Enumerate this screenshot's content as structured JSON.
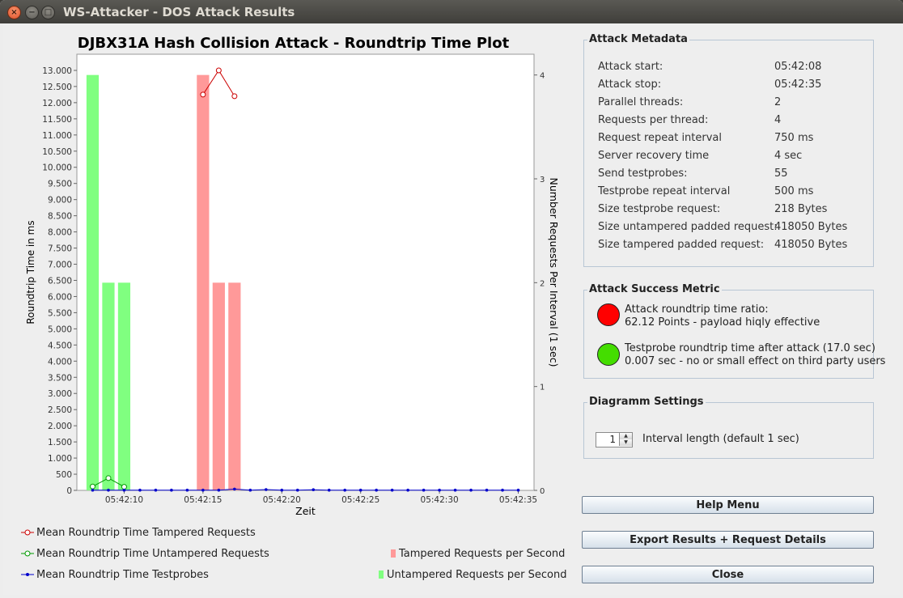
{
  "window": {
    "title": "WS-Attacker - DOS Attack Results",
    "close_glyph": "×",
    "min_glyph": "−",
    "max_glyph": "□"
  },
  "chart_data": {
    "type": "bar",
    "title": "DJBX31A Hash Collision Attack - Roundtrip Time Plot",
    "xlabel": "Zeit",
    "ylabel": "Roundtrip Time in ms",
    "y2label": "Number Requests Per Interval (1 sec)",
    "y_ticks": [
      "0",
      "500",
      "1.000",
      "1.500",
      "2.000",
      "2.500",
      "3.000",
      "3.500",
      "4.000",
      "4.500",
      "5.000",
      "5.500",
      "6.000",
      "6.500",
      "7.000",
      "7.500",
      "8.000",
      "8.500",
      "9.000",
      "9.500",
      "10.000",
      "10.500",
      "11.000",
      "11.500",
      "12.000",
      "12.500",
      "13.000"
    ],
    "y2_ticks": [
      "0",
      "1",
      "2",
      "3",
      "4"
    ],
    "x_ticks": [
      "05:42:10",
      "05:42:15",
      "05:42:20",
      "05:42:25",
      "05:42:30",
      "05:42:35"
    ],
    "x_range": [
      "05:42:07",
      "05:42:36"
    ],
    "ylim": [
      0,
      13500
    ],
    "y2lim": [
      0,
      4.2
    ],
    "grid": false,
    "bar_series": [
      {
        "name": "Untampered Requests per Second",
        "color": "#80ff80",
        "x": [
          "05:42:08",
          "05:42:09",
          "05:42:10"
        ],
        "values": [
          4,
          2,
          2
        ]
      },
      {
        "name": "Tampered Requests per Second",
        "color": "#ff9999",
        "x": [
          "05:42:15",
          "05:42:16",
          "05:42:17"
        ],
        "values": [
          4,
          2,
          2
        ]
      }
    ],
    "line_series": [
      {
        "name": "Mean Roundtrip Time Tampered Requests",
        "color": "#cc0000",
        "x": [
          "05:42:15",
          "05:42:16",
          "05:42:17"
        ],
        "values": [
          12250,
          13000,
          12200
        ]
      },
      {
        "name": "Mean Roundtrip Time Untampered Requests",
        "color": "#009900",
        "x": [
          "05:42:08",
          "05:42:09",
          "05:42:10"
        ],
        "values": [
          120,
          380,
          110
        ]
      },
      {
        "name": "Mean Roundtrip Time Testprobes",
        "color": "#0000cc",
        "x": [
          "05:42:08",
          "05:42:09",
          "05:42:10",
          "05:42:11",
          "05:42:12",
          "05:42:13",
          "05:42:14",
          "05:42:15",
          "05:42:16",
          "05:42:17",
          "05:42:18",
          "05:42:19",
          "05:42:20",
          "05:42:21",
          "05:42:22",
          "05:42:23",
          "05:42:24",
          "05:42:25",
          "05:42:26",
          "05:42:27",
          "05:42:28",
          "05:42:29",
          "05:42:30",
          "05:42:31",
          "05:42:32",
          "05:42:33",
          "05:42:34",
          "05:42:35"
        ],
        "values": [
          7,
          7,
          7,
          7,
          7,
          7,
          7,
          7,
          7,
          40,
          7,
          25,
          7,
          7,
          20,
          7,
          7,
          7,
          7,
          7,
          7,
          7,
          7,
          7,
          7,
          7,
          7,
          7
        ]
      }
    ],
    "legend_order_left": [
      "Mean Roundtrip Time Tampered Requests",
      "Mean Roundtrip Time Untampered Requests",
      "Mean Roundtrip Time Testprobes"
    ],
    "legend_order_right": [
      "Tampered Requests per Second",
      "Untampered Requests per Second"
    ]
  },
  "metadata": {
    "title": "Attack Metadata",
    "rows": [
      {
        "label": "Attack start:",
        "value": "05:42:08"
      },
      {
        "label": "Attack stop:",
        "value": "05:42:35"
      },
      {
        "label": "Parallel threads:",
        "value": "2"
      },
      {
        "label": "Requests per thread:",
        "value": "4"
      },
      {
        "label": "Request repeat interval",
        "value": "750 ms"
      },
      {
        "label": "Server recovery time",
        "value": "4 sec"
      },
      {
        "label": "Send testprobes:",
        "value": "55"
      },
      {
        "label": "Testprobe repeat interval",
        "value": "500 ms"
      },
      {
        "label": "Size testprobe request:",
        "value": "218 Bytes"
      },
      {
        "label": "Size untampered padded request:",
        "value": "418050 Bytes"
      },
      {
        "label": "Size tampered padded request:",
        "value": "418050 Bytes"
      }
    ]
  },
  "success": {
    "title": "Attack Success Metric",
    "items": [
      {
        "color": "#ff0000",
        "line1": "Attack roundtrip time ratio:",
        "line2": "62.12 Points - payload hiqly effective"
      },
      {
        "color": "#44dd00",
        "line1": "Testprobe roundtrip time after attack (17.0 sec)",
        "line2": "0.007 sec - no or small effect on third party users"
      }
    ]
  },
  "diagram_settings": {
    "title": "Diagramm Settings",
    "interval_value": "1",
    "interval_label": "Interval length (default 1 sec)"
  },
  "buttons": {
    "help": "Help Menu",
    "export": "Export Results + Request Details",
    "close": "Close"
  }
}
